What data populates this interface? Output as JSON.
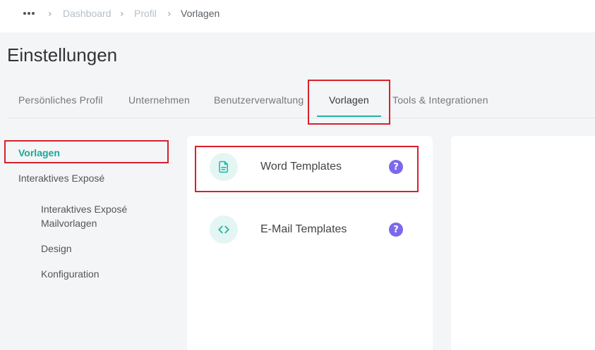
{
  "breadcrumb": {
    "items": [
      "Dashboard",
      "Profil",
      "Vorlagen"
    ]
  },
  "header": {
    "title": "Einstellungen"
  },
  "tabs": [
    {
      "label": "Persönliches Profil"
    },
    {
      "label": "Unternehmen"
    },
    {
      "label": "Benutzerverwaltung"
    },
    {
      "label": "Vorlagen",
      "active": true
    },
    {
      "label": "Tools & Integrationen"
    }
  ],
  "sidebar": {
    "items": [
      {
        "label": "Vorlagen",
        "active": true
      },
      {
        "label": "Interaktives Exposé"
      }
    ],
    "subitems": [
      {
        "label": "Interaktives Exposé Mailvorlagen"
      },
      {
        "label": "Design"
      },
      {
        "label": "Konfiguration"
      }
    ]
  },
  "templates": [
    {
      "label": "Word Templates",
      "icon": "document-icon"
    },
    {
      "label": "E-Mail Templates",
      "icon": "code-icon"
    }
  ],
  "help_glyph": "?",
  "colors": {
    "accent": "#1fb5a3",
    "help": "#7b68ee",
    "highlight": "#d9202b"
  }
}
